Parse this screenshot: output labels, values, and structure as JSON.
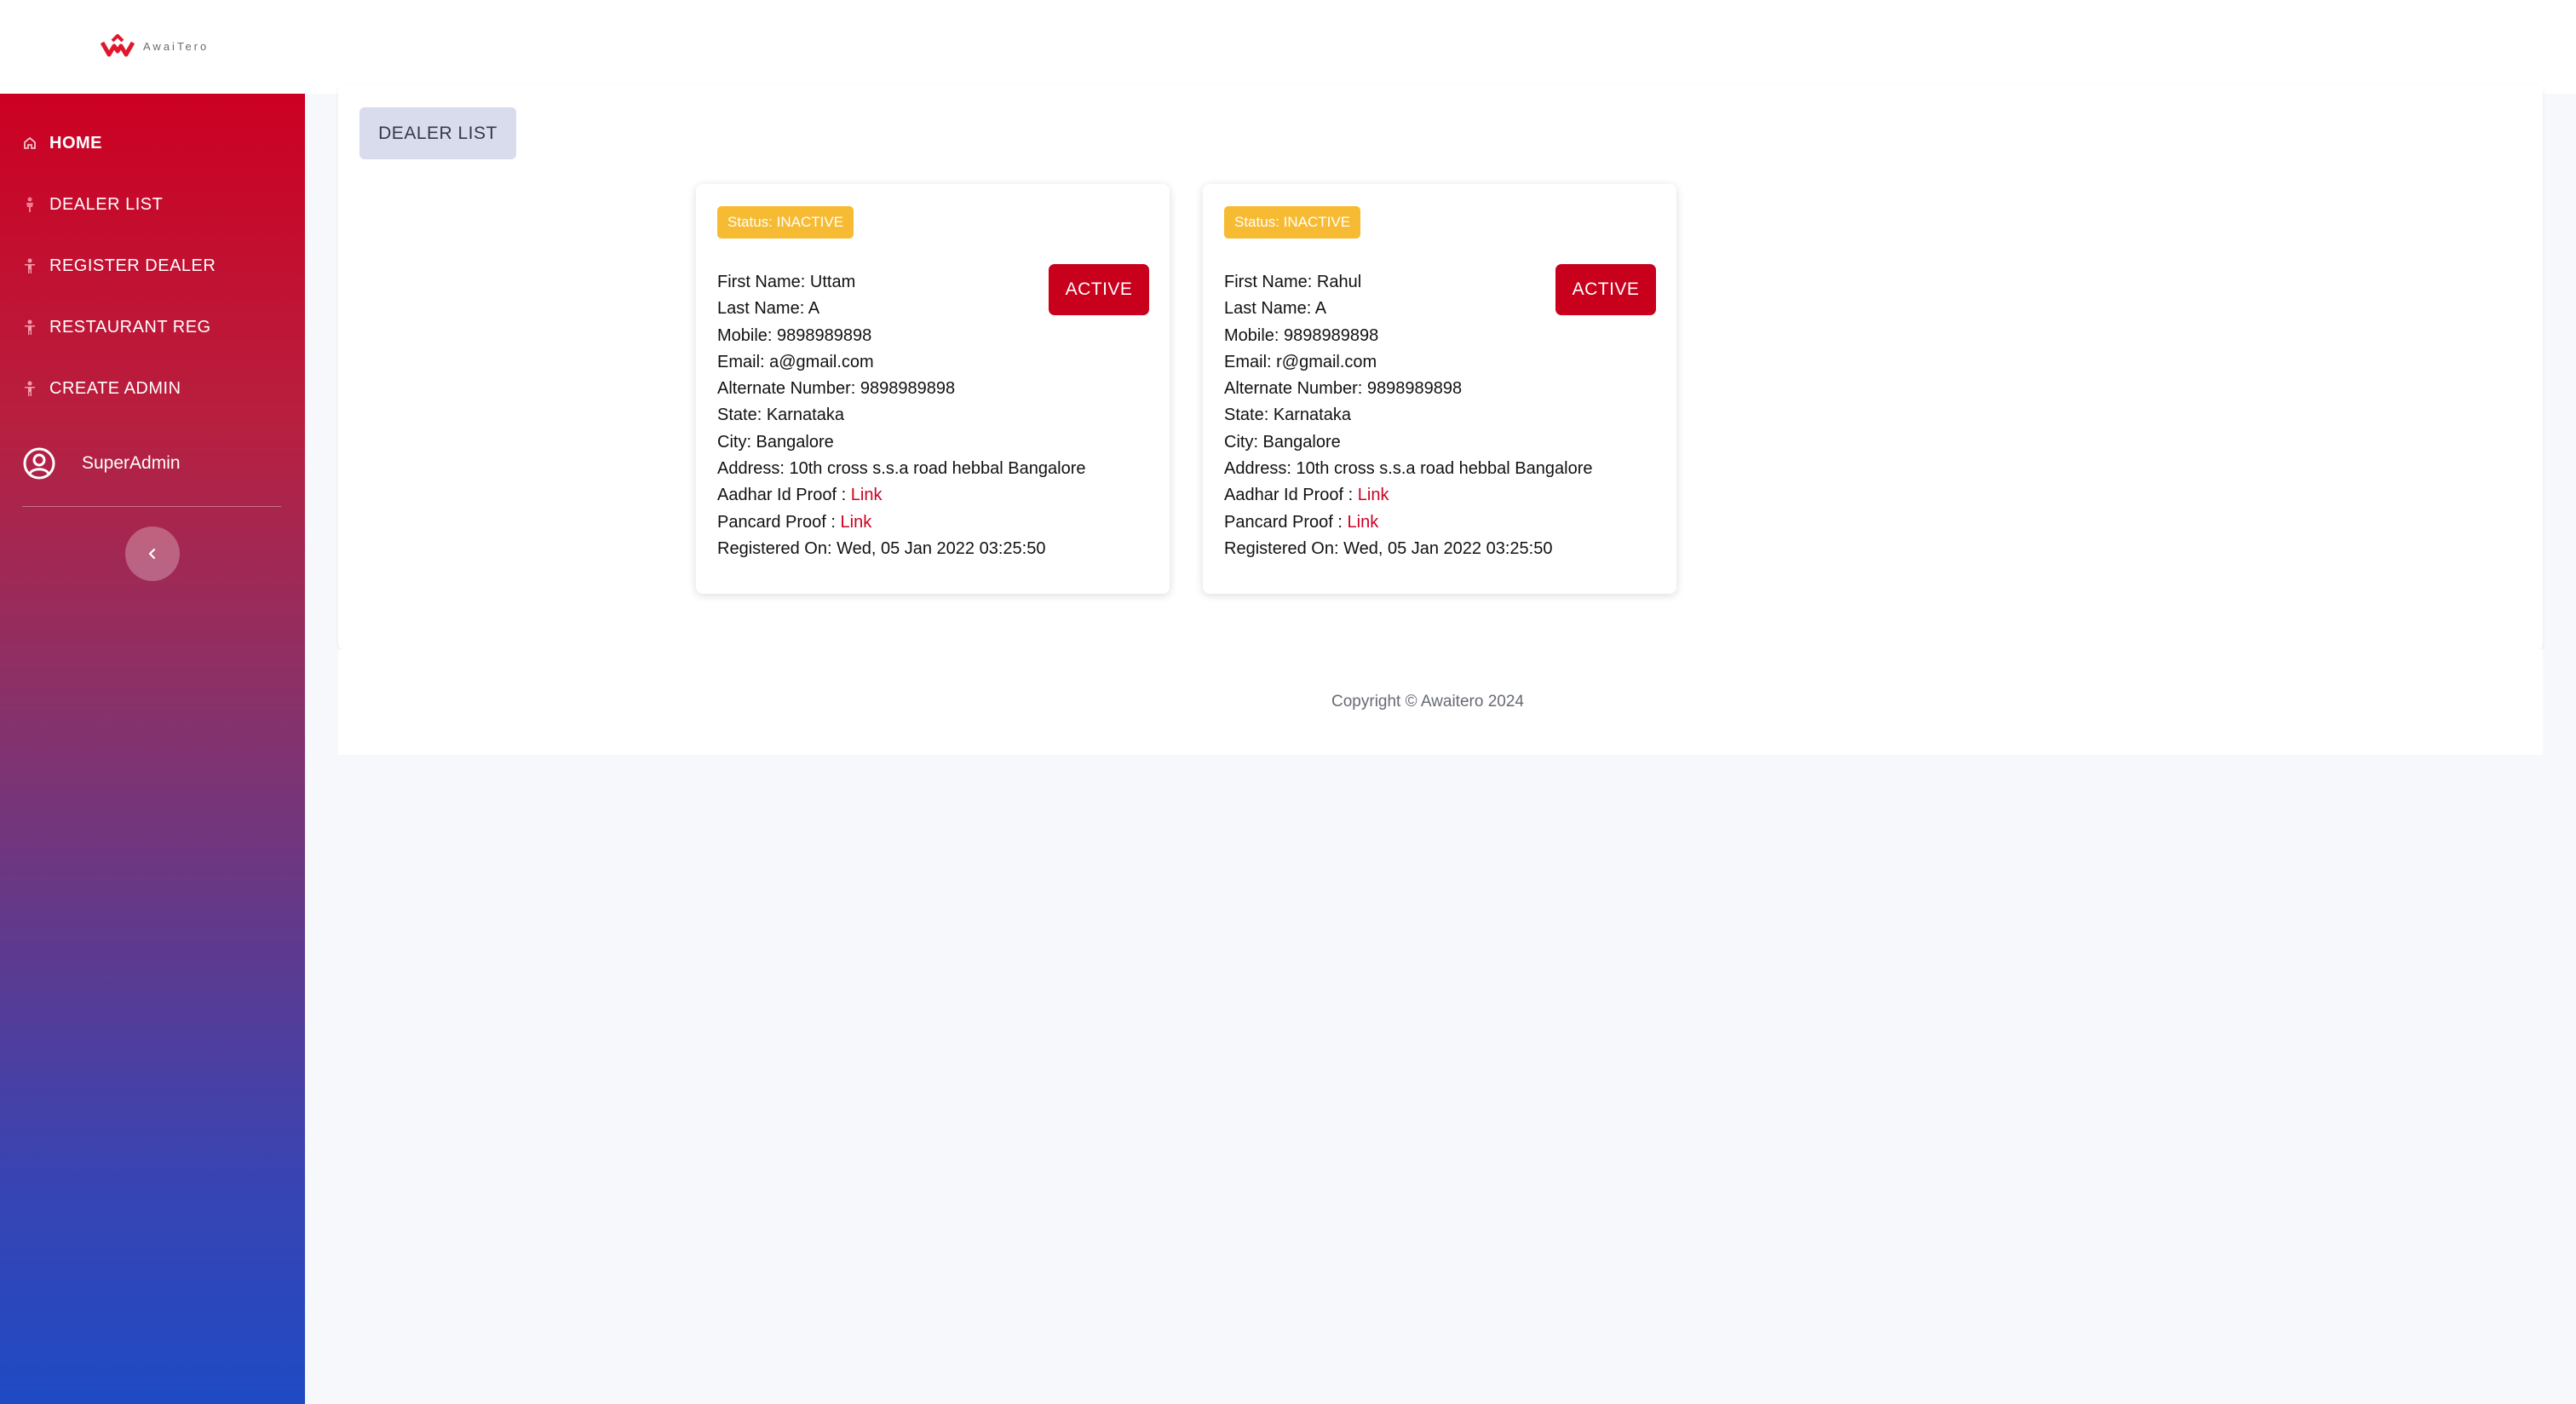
{
  "brand": {
    "logo_text": "AwaiTero",
    "primary_color": "#cc0022",
    "badge_color": "#f7bb33"
  },
  "sidebar": {
    "items": [
      {
        "label": "HOME",
        "icon": "home-icon",
        "active": true
      },
      {
        "label": "DEALER LIST",
        "icon": "person-icon",
        "active": false
      },
      {
        "label": "REGISTER DEALER",
        "icon": "person-icon",
        "active": false
      },
      {
        "label": "RESTAURANT REG",
        "icon": "person-icon",
        "active": false
      },
      {
        "label": "CREATE ADMIN",
        "icon": "person-icon",
        "active": false
      }
    ],
    "user": {
      "name": "SuperAdmin",
      "icon": "user-circle-icon"
    },
    "collapse_icon": "chevron-left-icon"
  },
  "main": {
    "tab_label": "DEALER LIST",
    "dealers": [
      {
        "status": "Status: INACTIVE",
        "action_label": "ACTIVE",
        "first_name": "First Name: Uttam",
        "last_name": "Last Name: A",
        "mobile": "Mobile: 9898989898",
        "email": "Email: a@gmail.com",
        "alternate": "Alternate Number: 9898989898",
        "state": "State: Karnataka",
        "city": "City: Bangalore",
        "address": "Address: 10th cross s.s.a road  hebbal Bangalore",
        "aadhar_label": "Aadhar Id Proof : ",
        "aadhar_link": "Link",
        "pancard_label": "Pancard Proof : ",
        "pancard_link": "Link",
        "registered": "Registered On: Wed, 05 Jan 2022 03:25:50"
      },
      {
        "status": "Status: INACTIVE",
        "action_label": "ACTIVE",
        "first_name": "First Name: Rahul",
        "last_name": "Last Name: A",
        "mobile": "Mobile: 9898989898",
        "email": "Email: r@gmail.com",
        "alternate": "Alternate Number: 9898989898",
        "state": "State: Karnataka",
        "city": "City: Bangalore",
        "address": "Address: 10th cross s.s.a road  hebbal Bangalore",
        "aadhar_label": "Aadhar Id Proof : ",
        "aadhar_link": "Link",
        "pancard_label": "Pancard Proof : ",
        "pancard_link": "Link",
        "registered": "Registered On: Wed, 05 Jan 2022 03:25:50"
      }
    ]
  },
  "footer": {
    "copyright": "Copyright © Awaitero 2024"
  }
}
